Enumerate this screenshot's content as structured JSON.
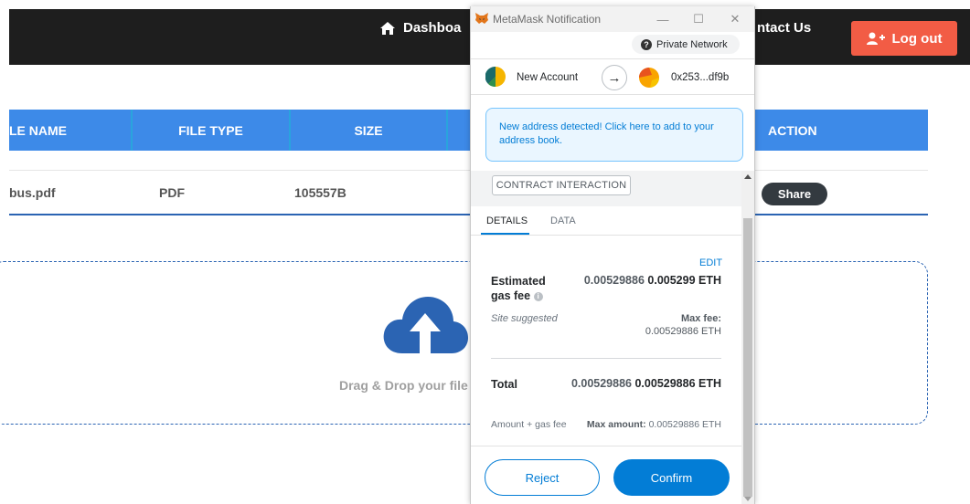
{
  "app": {
    "nav": {
      "dashboard_label": "Dashboa",
      "contact_label": "ntact Us",
      "logout_label": "Log out"
    },
    "table": {
      "headers": [
        "LE NAME",
        "FILE TYPE",
        "SIZE",
        "",
        "ACTION"
      ],
      "rows": [
        {
          "name": "bus.pdf",
          "type": "PDF",
          "size": "105557B",
          "action": "Share"
        }
      ]
    },
    "dropzone": {
      "text": "Drag & Drop your file"
    }
  },
  "metamask": {
    "window_title": "MetaMask Notification",
    "network": "Private Network",
    "from_account": "New Account",
    "to_account": "0x253...df9b",
    "alert": "New address detected! Click here to add to your address book.",
    "contract_tag": "CONTRACT INTERACTION",
    "tabs": [
      "DETAILS",
      "DATA"
    ],
    "edit_label": "EDIT",
    "gas": {
      "label": "Estimated gas fee",
      "secondary": "0.00529886",
      "primary": "0.005299 ETH",
      "suggested": "Site suggested",
      "max_fee_label": "Max fee:",
      "max_fee_value": "0.00529886 ETH"
    },
    "total": {
      "label": "Total",
      "secondary": "0.00529886",
      "primary": "0.00529886 ETH",
      "subtitle": "Amount + gas fee",
      "max_amount_label": "Max amount:",
      "max_amount_value": "0.00529886 ETH"
    },
    "buttons": {
      "reject": "Reject",
      "confirm": "Confirm"
    }
  },
  "colors": {
    "topbar": "#1e1e1e",
    "logout": "#f25c45",
    "table_header": "#3d8ae8",
    "metamask_blue": "#037dd6"
  }
}
